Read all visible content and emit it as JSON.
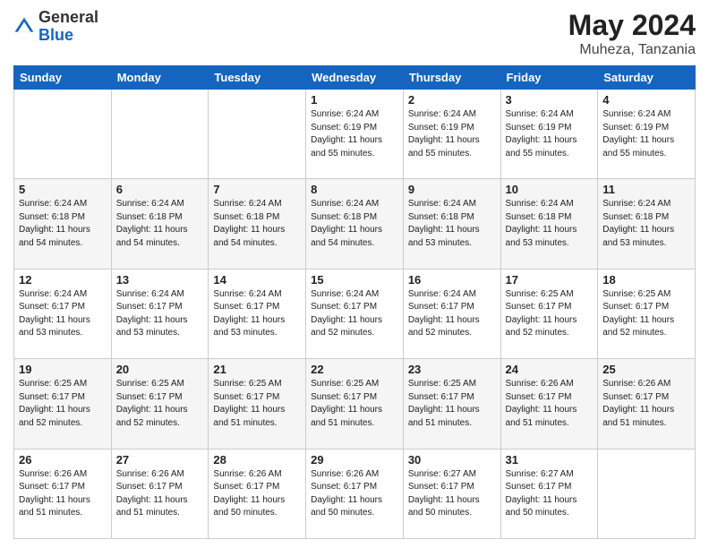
{
  "header": {
    "logo_general": "General",
    "logo_blue": "Blue",
    "month_year": "May 2024",
    "location": "Muheza, Tanzania"
  },
  "days_of_week": [
    "Sunday",
    "Monday",
    "Tuesday",
    "Wednesday",
    "Thursday",
    "Friday",
    "Saturday"
  ],
  "weeks": [
    [
      {
        "day": "",
        "info": ""
      },
      {
        "day": "",
        "info": ""
      },
      {
        "day": "",
        "info": ""
      },
      {
        "day": "1",
        "info": "Sunrise: 6:24 AM\nSunset: 6:19 PM\nDaylight: 11 hours\nand 55 minutes."
      },
      {
        "day": "2",
        "info": "Sunrise: 6:24 AM\nSunset: 6:19 PM\nDaylight: 11 hours\nand 55 minutes."
      },
      {
        "day": "3",
        "info": "Sunrise: 6:24 AM\nSunset: 6:19 PM\nDaylight: 11 hours\nand 55 minutes."
      },
      {
        "day": "4",
        "info": "Sunrise: 6:24 AM\nSunset: 6:19 PM\nDaylight: 11 hours\nand 55 minutes."
      }
    ],
    [
      {
        "day": "5",
        "info": "Sunrise: 6:24 AM\nSunset: 6:18 PM\nDaylight: 11 hours\nand 54 minutes."
      },
      {
        "day": "6",
        "info": "Sunrise: 6:24 AM\nSunset: 6:18 PM\nDaylight: 11 hours\nand 54 minutes."
      },
      {
        "day": "7",
        "info": "Sunrise: 6:24 AM\nSunset: 6:18 PM\nDaylight: 11 hours\nand 54 minutes."
      },
      {
        "day": "8",
        "info": "Sunrise: 6:24 AM\nSunset: 6:18 PM\nDaylight: 11 hours\nand 54 minutes."
      },
      {
        "day": "9",
        "info": "Sunrise: 6:24 AM\nSunset: 6:18 PM\nDaylight: 11 hours\nand 53 minutes."
      },
      {
        "day": "10",
        "info": "Sunrise: 6:24 AM\nSunset: 6:18 PM\nDaylight: 11 hours\nand 53 minutes."
      },
      {
        "day": "11",
        "info": "Sunrise: 6:24 AM\nSunset: 6:18 PM\nDaylight: 11 hours\nand 53 minutes."
      }
    ],
    [
      {
        "day": "12",
        "info": "Sunrise: 6:24 AM\nSunset: 6:17 PM\nDaylight: 11 hours\nand 53 minutes."
      },
      {
        "day": "13",
        "info": "Sunrise: 6:24 AM\nSunset: 6:17 PM\nDaylight: 11 hours\nand 53 minutes."
      },
      {
        "day": "14",
        "info": "Sunrise: 6:24 AM\nSunset: 6:17 PM\nDaylight: 11 hours\nand 53 minutes."
      },
      {
        "day": "15",
        "info": "Sunrise: 6:24 AM\nSunset: 6:17 PM\nDaylight: 11 hours\nand 52 minutes."
      },
      {
        "day": "16",
        "info": "Sunrise: 6:24 AM\nSunset: 6:17 PM\nDaylight: 11 hours\nand 52 minutes."
      },
      {
        "day": "17",
        "info": "Sunrise: 6:25 AM\nSunset: 6:17 PM\nDaylight: 11 hours\nand 52 minutes."
      },
      {
        "day": "18",
        "info": "Sunrise: 6:25 AM\nSunset: 6:17 PM\nDaylight: 11 hours\nand 52 minutes."
      }
    ],
    [
      {
        "day": "19",
        "info": "Sunrise: 6:25 AM\nSunset: 6:17 PM\nDaylight: 11 hours\nand 52 minutes."
      },
      {
        "day": "20",
        "info": "Sunrise: 6:25 AM\nSunset: 6:17 PM\nDaylight: 11 hours\nand 52 minutes."
      },
      {
        "day": "21",
        "info": "Sunrise: 6:25 AM\nSunset: 6:17 PM\nDaylight: 11 hours\nand 51 minutes."
      },
      {
        "day": "22",
        "info": "Sunrise: 6:25 AM\nSunset: 6:17 PM\nDaylight: 11 hours\nand 51 minutes."
      },
      {
        "day": "23",
        "info": "Sunrise: 6:25 AM\nSunset: 6:17 PM\nDaylight: 11 hours\nand 51 minutes."
      },
      {
        "day": "24",
        "info": "Sunrise: 6:26 AM\nSunset: 6:17 PM\nDaylight: 11 hours\nand 51 minutes."
      },
      {
        "day": "25",
        "info": "Sunrise: 6:26 AM\nSunset: 6:17 PM\nDaylight: 11 hours\nand 51 minutes."
      }
    ],
    [
      {
        "day": "26",
        "info": "Sunrise: 6:26 AM\nSunset: 6:17 PM\nDaylight: 11 hours\nand 51 minutes."
      },
      {
        "day": "27",
        "info": "Sunrise: 6:26 AM\nSunset: 6:17 PM\nDaylight: 11 hours\nand 51 minutes."
      },
      {
        "day": "28",
        "info": "Sunrise: 6:26 AM\nSunset: 6:17 PM\nDaylight: 11 hours\nand 50 minutes."
      },
      {
        "day": "29",
        "info": "Sunrise: 6:26 AM\nSunset: 6:17 PM\nDaylight: 11 hours\nand 50 minutes."
      },
      {
        "day": "30",
        "info": "Sunrise: 6:27 AM\nSunset: 6:17 PM\nDaylight: 11 hours\nand 50 minutes."
      },
      {
        "day": "31",
        "info": "Sunrise: 6:27 AM\nSunset: 6:17 PM\nDaylight: 11 hours\nand 50 minutes."
      },
      {
        "day": "",
        "info": ""
      }
    ]
  ]
}
